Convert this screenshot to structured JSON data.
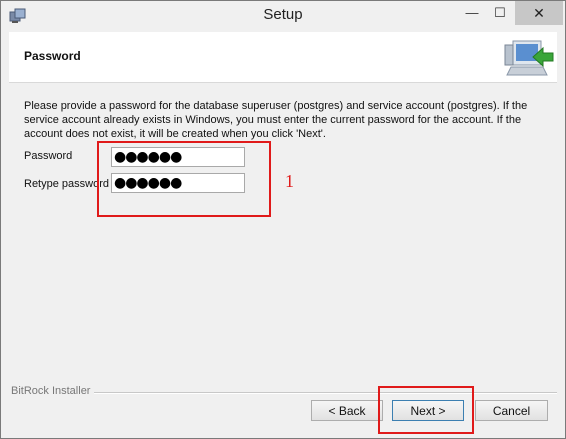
{
  "window": {
    "title": "Setup",
    "minimize_glyph": "—",
    "maximize_glyph": "☐",
    "close_glyph": "✕"
  },
  "header": {
    "title": "Password",
    "icon": "computer-arrow-icon"
  },
  "content": {
    "description": "Please provide a password for the database superuser (postgres) and service account (postgres). If the service account already exists in Windows, you must enter the current password for the account. If the account does not exist, it will be created when you click 'Next'.",
    "password_label": "Password",
    "password_value": "●●●●●●",
    "retype_label": "Retype password",
    "retype_value": "●●●●●●"
  },
  "annotation": {
    "number": "1",
    "color": "#e01a1a"
  },
  "footer": {
    "installer_label": "BitRock Installer",
    "back_label": "< Back",
    "next_label": "Next >",
    "cancel_label": "Cancel"
  }
}
